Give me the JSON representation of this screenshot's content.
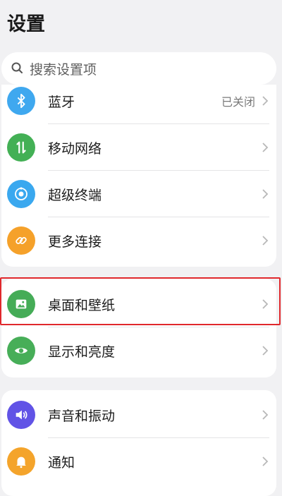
{
  "header": {
    "title": "设置"
  },
  "search": {
    "placeholder": "搜索设置项"
  },
  "groups": [
    {
      "items": [
        {
          "label": "蓝牙",
          "value": "已关闭",
          "icon": "bluetooth-icon",
          "color": "#3fa8ef"
        },
        {
          "label": "移动网络",
          "value": "",
          "icon": "mobile-data-icon",
          "color": "#43b055"
        },
        {
          "label": "超级终端",
          "value": "",
          "icon": "super-device-icon",
          "color": "#3aa8ef"
        },
        {
          "label": "更多连接",
          "value": "",
          "icon": "link-icon",
          "color": "#f5a12a"
        }
      ]
    },
    {
      "items": [
        {
          "label": "桌面和壁纸",
          "value": "",
          "icon": "wallpaper-icon",
          "color": "#45ac57",
          "highlighted": true
        },
        {
          "label": "显示和亮度",
          "value": "",
          "icon": "eye-icon",
          "color": "#47ae58"
        }
      ]
    },
    {
      "items": [
        {
          "label": "声音和振动",
          "value": "",
          "icon": "sound-icon",
          "color": "#6153e6"
        },
        {
          "label": "通知",
          "value": "",
          "icon": "bell-icon",
          "color": "#f4a42b"
        }
      ]
    }
  ],
  "colors": {
    "highlight": "#e0282c",
    "background": "#f1f1f3"
  }
}
